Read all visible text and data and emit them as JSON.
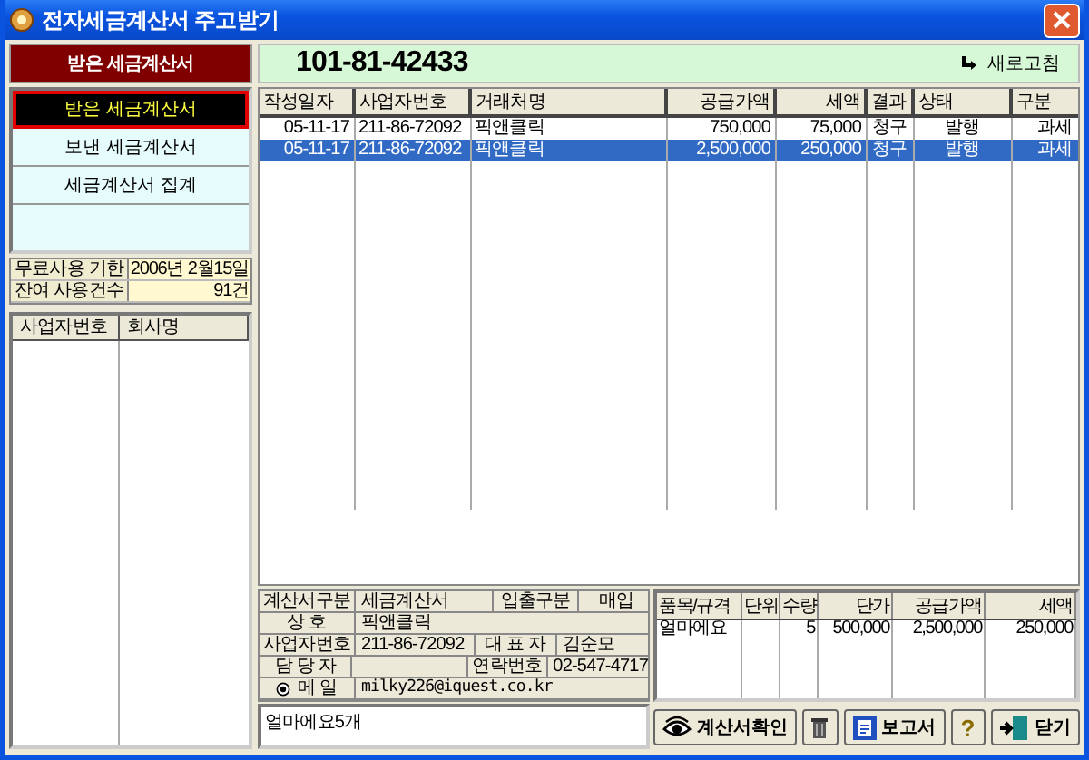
{
  "window": {
    "title": "전자세금계산서 주고받기"
  },
  "section_title": "받은 세금계산서",
  "business_number": "101-81-42433",
  "refresh_button": "새로고침",
  "menu": [
    {
      "label": "받은 세금계산서",
      "selected": true
    },
    {
      "label": "보낸 세금계산서",
      "selected": false
    },
    {
      "label": "세금계산서 집계",
      "selected": false
    }
  ],
  "usage": [
    {
      "label": "무료사용 기한",
      "value": "2006년 2월15일"
    },
    {
      "label": "잔여 사용건수",
      "value": "91건"
    }
  ],
  "company_list": {
    "columns": [
      "사업자번호",
      "회사명"
    ]
  },
  "invoices": {
    "columns": [
      "작성일자",
      "사업자번호",
      "거래처명",
      "공급가액",
      "세액",
      "결과",
      "상태",
      "구분"
    ],
    "rows": [
      {
        "cells": [
          "05-11-17",
          "211-86-72092",
          "픽앤클릭",
          "750,000",
          "75,000",
          "청구",
          "발행",
          "과세"
        ],
        "selected": false
      },
      {
        "cells": [
          "05-11-17",
          "211-86-72092",
          "픽앤클릭",
          "2,500,000",
          "250,000",
          "청구",
          "발행",
          "과세"
        ],
        "selected": true
      }
    ]
  },
  "detail": {
    "type_label": "계산서구분",
    "type_value": "세금계산서",
    "io_label": "입출구분",
    "io_value": "매입",
    "company_label": "상 호",
    "company_value": "픽앤클릭",
    "bizno_label": "사업자번호",
    "bizno_value": "211-86-72092",
    "ceo_label": "대 표 자",
    "ceo_value": "김순모",
    "manager_label": "담 당 자",
    "phone_label": "연락번호",
    "phone_value": "02-547-4717",
    "email_label": "메 일",
    "email_value": "milky226@iquest.co.kr"
  },
  "memo": "얼마에요5개",
  "items": {
    "columns": [
      "품목/규격",
      "단위",
      "수량",
      "단가",
      "공급가액",
      "세액"
    ],
    "rows": [
      [
        "얼마에요",
        "",
        "5",
        "500,000",
        "2,500,000",
        "250,000"
      ]
    ]
  },
  "buttons": [
    {
      "kind": "eye",
      "label": "계산서확인"
    },
    {
      "kind": "trash"
    },
    {
      "kind": "report",
      "label": "보고서"
    },
    {
      "kind": "help",
      "label": "?"
    },
    {
      "kind": "exit",
      "label": "닫기"
    }
  ]
}
